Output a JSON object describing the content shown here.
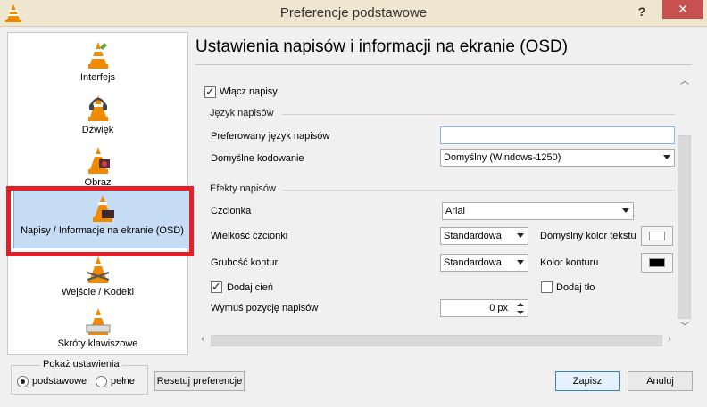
{
  "window": {
    "title": "Preferencje podstawowe",
    "help_label": "?",
    "close_label": "✕"
  },
  "sidebar": {
    "items": [
      {
        "label": "Interfejs"
      },
      {
        "label": "Dźwięk"
      },
      {
        "label": "Obraz"
      },
      {
        "label": "Napisy / Informacje na ekranie (OSD)",
        "selected": true
      },
      {
        "label": "Wejście / Kodeki"
      },
      {
        "label": "Skróty klawiszowe"
      }
    ]
  },
  "panel": {
    "title": "Ustawienia napisów i informacji na ekranie (OSD)",
    "enable_subtitles": {
      "label": "Włącz napisy",
      "checked": true
    },
    "language_group": {
      "title": "Język napisów",
      "preferred_language": {
        "label": "Preferowany język napisów",
        "value": ""
      },
      "default_encoding": {
        "label": "Domyślne kodowanie",
        "value": "Domyślny (Windows-1250)"
      }
    },
    "effects_group": {
      "title": "Efekty napisów",
      "font": {
        "label": "Czcionka",
        "value": "Arial"
      },
      "font_size": {
        "label": "Wielkość czcionki",
        "value": "Standardowa"
      },
      "text_color": {
        "label": "Domyślny kolor tekstu",
        "color": "#ffffff"
      },
      "outline_thickness": {
        "label": "Grubość kontur",
        "value": "Standardowa"
      },
      "outline_color": {
        "label": "Kolor konturu",
        "color": "#000000"
      },
      "shadow": {
        "label": "Dodaj cień",
        "checked": true
      },
      "background": {
        "label": "Dodaj tło",
        "checked": false
      },
      "force_position": {
        "label": "Wymuś pozycję napisów",
        "value": "0 px"
      }
    }
  },
  "show_settings": {
    "legend": "Pokaż ustawienia",
    "options": [
      {
        "label": "podstawowe",
        "selected": true
      },
      {
        "label": "pełne",
        "selected": false
      }
    ]
  },
  "buttons": {
    "reset": "Resetuj preferencje",
    "save": "Zapisz",
    "cancel": "Anuluj"
  },
  "colors": {
    "selection_bg": "#c5dcf4",
    "highlight_border": "#e32026",
    "close_button": "#c75050",
    "titlebar": "#f0e6cf"
  }
}
